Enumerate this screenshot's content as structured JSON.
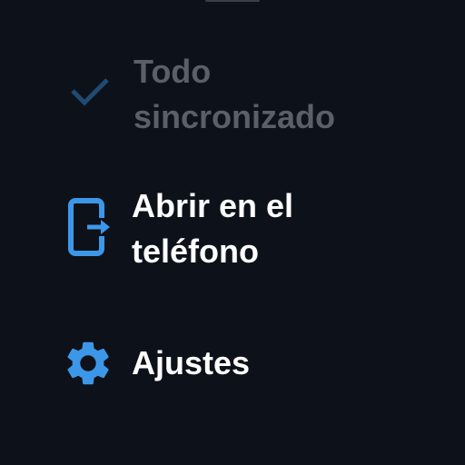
{
  "menu": {
    "items": [
      {
        "icon": "checkmark-icon",
        "label_line1": "Todo",
        "label_line2": "sincronizado",
        "state": "disabled"
      },
      {
        "icon": "open-on-phone-icon",
        "label_line1": "Abrir en el",
        "label_line2": "teléfono"
      },
      {
        "icon": "gear-icon",
        "label": "Ajustes"
      }
    ]
  },
  "colors": {
    "background": "#0d1119",
    "accent": "#3d97e8",
    "checkmark": "#1f4b73",
    "text_primary": "#ffffff",
    "text_disabled": "#5a5f69"
  }
}
